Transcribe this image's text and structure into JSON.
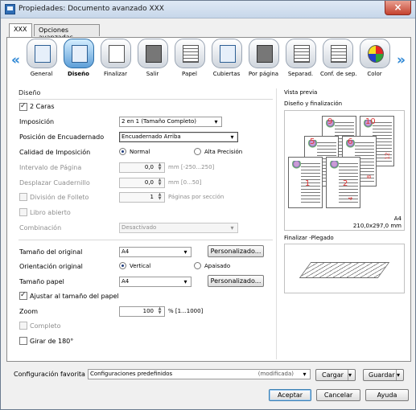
{
  "window": {
    "title": "Propiedades: Documento avanzado XXX",
    "close_symbol": "×"
  },
  "tabs": [
    {
      "label": "XXX"
    },
    {
      "label": "Opciones avanzadas"
    }
  ],
  "toolbar": {
    "left_arrow": "«",
    "right_arrow": "»",
    "items": [
      {
        "label": "General"
      },
      {
        "label": "Diseño"
      },
      {
        "label": "Finalizar"
      },
      {
        "label": "Salir"
      },
      {
        "label": "Papel"
      },
      {
        "label": "Cubiertas"
      },
      {
        "label": "Por página"
      },
      {
        "label": "Separad."
      },
      {
        "label": "Conf. de sep."
      },
      {
        "label": "Color"
      }
    ]
  },
  "design": {
    "section": "Diseño",
    "two_sides": "2 Caras",
    "imposition_label": "Imposición",
    "imposition_value": "2 en 1 (Tamaño Completo)",
    "binding_label": "Posición de Encuadernado",
    "binding_value": "Encuadernado Arriba",
    "quality_label": "Calidad de Imposición",
    "normal": "Normal",
    "high": "Alta Precisión",
    "page_interval_label": "Intervalo de Página",
    "page_interval_value": "0,0",
    "page_interval_unit": "mm [-250...250]",
    "shift_label": "Desplazar Cuadernillo",
    "shift_value": "0,0",
    "shift_unit": "mm [0...50]",
    "booklet_label": "División de Folleto",
    "booklet_value": "1",
    "booklet_unit": "Páginas por sección",
    "open_book": "Libro abierto",
    "combination_label": "Combinación",
    "combination_value": "Desactivado",
    "original_size_label": "Tamaño del original",
    "original_size_value": "A4",
    "custom": "Personalizado...",
    "orientation_label": "Orientación original",
    "vertical": "Vertical",
    "landscape": "Apaisado",
    "paper_size_label": "Tamaño papel",
    "paper_size_value": "A4",
    "fit_paper": "Ajustar al tamaño del papel",
    "zoom_label": "Zoom",
    "zoom_value": "100",
    "zoom_unit": "% [1...1000]",
    "complete": "Completo",
    "rotate": "Girar de 180°"
  },
  "preview": {
    "title": "Vista previa",
    "design_title": "Diseño y finalización",
    "size_a4": "A4",
    "size_mm": "210,0x297,0 mm",
    "fold_title": "Finalizar -Plegado",
    "page_numbers": [
      "9",
      "10",
      "5",
      "6",
      "1",
      "2",
      "4",
      "8",
      "12"
    ]
  },
  "favorite": {
    "label": "Configuración favorita",
    "value": "Configuraciones predefinidos",
    "status": "(modificada)",
    "load": "Cargar",
    "save": "Guardar"
  },
  "buttons": {
    "accept": "Aceptar",
    "cancel": "Cancelar",
    "help": "Ayuda"
  },
  "symbols": {
    "dropdown": "▾",
    "spin_up": "▲",
    "spin_down": "▼"
  }
}
